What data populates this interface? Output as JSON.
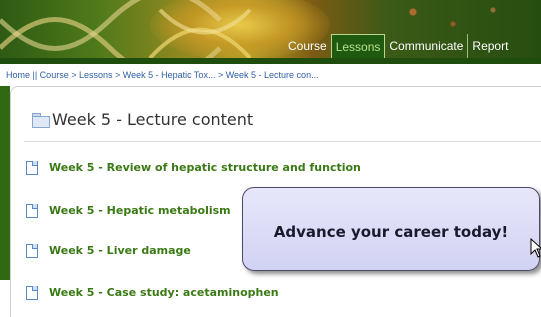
{
  "header": {
    "nav": [
      {
        "label": "Course",
        "active": false
      },
      {
        "label": "Lessons",
        "active": true
      },
      {
        "label": "Communicate",
        "active": false
      },
      {
        "label": "Report",
        "active": false
      }
    ]
  },
  "breadcrumb": "Home || Course > Lessons > Week 5 - Hepatic Tox... > Week 5 - Lecture con...",
  "main": {
    "title": "Week 5 - Lecture content",
    "lessons": [
      "Week 5 - Review of hepatic structure and function",
      "Week 5 - Hepatic metabolism",
      "Week 5 - Liver damage",
      "Week 5 - Case study: acetaminophen"
    ]
  },
  "ad": {
    "text": "Advance your career today!"
  },
  "icons": {
    "folder": "folder-icon",
    "document": "document-icon",
    "cursor": "cursor-arrow-icon"
  },
  "colors": {
    "brand_green": "#2f6a12",
    "link_green": "#3a7a14",
    "ad_background": "#d8d8f5"
  }
}
